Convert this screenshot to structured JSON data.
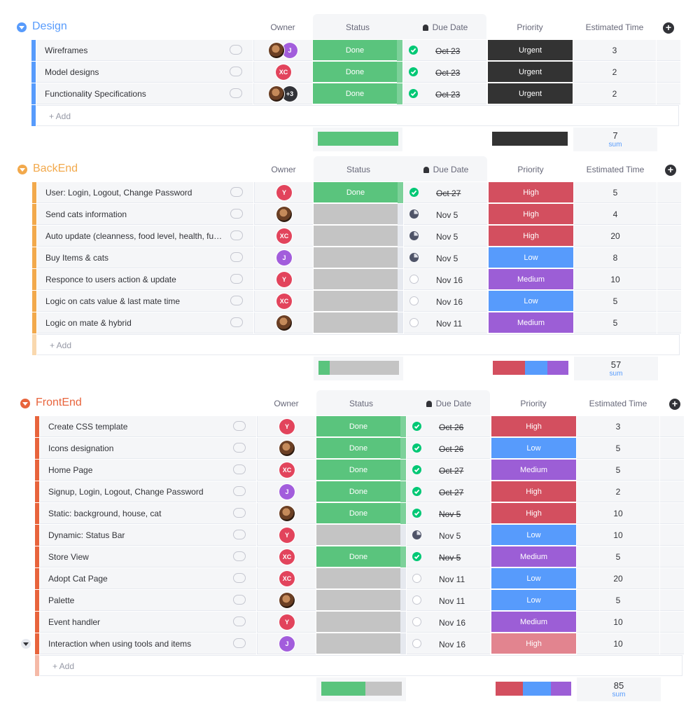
{
  "columns": {
    "owner": "Owner",
    "status": "Status",
    "due_date": "Due Date",
    "priority": "Priority",
    "estimated_time": "Estimated Time",
    "add_row": "+ Add",
    "sum_label": "sum"
  },
  "colors": {
    "done": "#5ac47d",
    "empty_status": "#c4c4c4",
    "urgent": "#333333",
    "high": "#d34f5f",
    "high_light": "#e2848f",
    "low": "#579bfc",
    "medium": "#9c5ed6",
    "design": "#579bfc",
    "backend": "#f2a94c",
    "frontend": "#e8643c"
  },
  "groups": [
    {
      "title": "Design",
      "color": "#579bfc",
      "rows": [
        {
          "name": "Wireframes",
          "owners": [
            "photo",
            "J"
          ],
          "status": "Done",
          "date": "Oct 23",
          "date_state": "done",
          "priority": "Urgent",
          "est": "3"
        },
        {
          "name": "Model designs",
          "owners": [
            "XC"
          ],
          "status": "Done",
          "date": "Oct 23",
          "date_state": "done",
          "priority": "Urgent",
          "est": "2"
        },
        {
          "name": "Functionality Specifications",
          "owners": [
            "photo",
            "+3"
          ],
          "status": "Done",
          "date": "Oct 23",
          "date_state": "done",
          "priority": "Urgent",
          "est": "2"
        }
      ],
      "sum": "7",
      "status_summary": [
        1.0
      ],
      "priority_summary": [
        1.0
      ]
    },
    {
      "title": "BackEnd",
      "color": "#f2a94c",
      "rows": [
        {
          "name": "User: Login, Logout, Change Password",
          "owners": [
            "Y"
          ],
          "status": "Done",
          "date": "Oct 27",
          "date_state": "done",
          "priority": "High",
          "est": "5"
        },
        {
          "name": "Send cats information",
          "owners": [
            "photo"
          ],
          "status": "",
          "date": "Nov 5",
          "date_state": "due",
          "priority": "High",
          "est": "4"
        },
        {
          "name": "Auto update (cleanness, food level, health, fur am...",
          "owners": [
            "XC"
          ],
          "status": "",
          "date": "Nov 5",
          "date_state": "due",
          "priority": "High",
          "est": "20"
        },
        {
          "name": "Buy Items & cats",
          "owners": [
            "J"
          ],
          "status": "",
          "date": "Nov 5",
          "date_state": "due",
          "priority": "Low",
          "est": "8"
        },
        {
          "name": "Responce to users action & update",
          "owners": [
            "Y"
          ],
          "status": "",
          "date": "Nov 16",
          "date_state": "open",
          "priority": "Medium",
          "est": "10"
        },
        {
          "name": "Logic on cats value & last mate time",
          "owners": [
            "XC"
          ],
          "status": "",
          "date": "Nov 16",
          "date_state": "open",
          "priority": "Low",
          "est": "5"
        },
        {
          "name": "Logic on mate & hybrid",
          "owners": [
            "photo"
          ],
          "status": "",
          "date": "Nov 11",
          "date_state": "open",
          "priority": "Medium",
          "est": "5"
        }
      ],
      "sum": "57",
      "status_summary": [
        0.14,
        0.86
      ],
      "priority_summary": [
        0.43,
        0.29,
        0.28
      ]
    },
    {
      "title": "FrontEnd",
      "color": "#e8643c",
      "rows": [
        {
          "name": "Create CSS template",
          "owners": [
            "Y"
          ],
          "status": "Done",
          "date": "Oct 26",
          "date_state": "done",
          "priority": "High",
          "est": "3"
        },
        {
          "name": "Icons designation",
          "owners": [
            "photo"
          ],
          "status": "Done",
          "date": "Oct 26",
          "date_state": "done",
          "priority": "Low",
          "est": "5"
        },
        {
          "name": "Home Page",
          "owners": [
            "XC"
          ],
          "status": "Done",
          "date": "Oct 27",
          "date_state": "done",
          "priority": "Medium",
          "est": "5"
        },
        {
          "name": "Signup, Login, Logout, Change Password",
          "owners": [
            "J"
          ],
          "status": "Done",
          "date": "Oct 27",
          "date_state": "done",
          "priority": "High",
          "est": "2"
        },
        {
          "name": "Static: background, house, cat",
          "owners": [
            "photo"
          ],
          "status": "Done",
          "date": "Nov 5",
          "date_state": "done",
          "priority": "High",
          "est": "10"
        },
        {
          "name": "Dynamic: Status Bar",
          "owners": [
            "Y"
          ],
          "status": "",
          "date": "Nov 5",
          "date_state": "due",
          "priority": "Low",
          "est": "10"
        },
        {
          "name": "Store View",
          "owners": [
            "XC"
          ],
          "status": "Done",
          "date": "Nov 5",
          "date_state": "done",
          "priority": "Medium",
          "est": "5"
        },
        {
          "name": "Adopt Cat Page",
          "owners": [
            "XC"
          ],
          "status": "",
          "date": "Nov 11",
          "date_state": "open",
          "priority": "Low",
          "est": "20"
        },
        {
          "name": "Palette",
          "owners": [
            "photo"
          ],
          "status": "",
          "date": "Nov 11",
          "date_state": "open",
          "priority": "Low",
          "est": "5"
        },
        {
          "name": "Event handler",
          "owners": [
            "Y"
          ],
          "status": "",
          "date": "Nov 16",
          "date_state": "open",
          "priority": "Medium",
          "est": "10"
        },
        {
          "name": "Interaction when using tools and items",
          "owners": [
            "J"
          ],
          "status": "",
          "date": "Nov 16",
          "date_state": "open",
          "priority": "High",
          "est": "10",
          "priority_light": true,
          "expand": true
        }
      ],
      "sum": "85",
      "status_summary": [
        0.55,
        0.45
      ],
      "priority_summary": [
        0.36,
        0.37,
        0.27
      ]
    }
  ]
}
